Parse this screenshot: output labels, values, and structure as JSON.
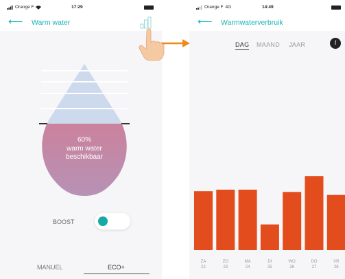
{
  "left_screen": {
    "status": {
      "carrier": "Orange F",
      "time": "17:29"
    },
    "nav": {
      "back_icon": "arrow-left-icon",
      "title": "Warm water",
      "chart_icon": "bar-chart-icon"
    },
    "tank": {
      "level_percent": 60,
      "line1": "60%",
      "line2": "warm water",
      "line3": "beschikbaar",
      "fill_color": "#d37f8e"
    },
    "boost": {
      "label": "BOOST",
      "on": false,
      "knob_color": "#17a8a8"
    },
    "modes": {
      "items": [
        "MANUEL",
        "ECO+"
      ],
      "active": "ECO+"
    }
  },
  "overlay": {
    "hand_icon": "pointing-hand-icon",
    "arrow_icon": "arrow-right-icon",
    "arrow_color": "#ee8a1c"
  },
  "right_screen": {
    "status": {
      "carrier": "Orange F",
      "network": "4G",
      "time": "14:49"
    },
    "nav": {
      "back_icon": "arrow-left-icon",
      "title": "Warmwaterverbruik"
    },
    "period_tabs": {
      "items": [
        "DAG",
        "MAAND",
        "JAAR"
      ],
      "active": "DAG"
    },
    "info_icon": "info-icon",
    "info_label": "i",
    "accent_color": "#17b3b5",
    "bar_color": "#e34d1e"
  },
  "chart_data": {
    "type": "bar",
    "categories": [
      "ZA 22",
      "ZO 23",
      "MA 24",
      "DI 25",
      "WO 26",
      "DO 27",
      "VR 28"
    ],
    "day_labels": [
      "ZA",
      "ZO",
      "MA",
      "DI",
      "WO",
      "DO",
      "VR"
    ],
    "date_labels": [
      "22",
      "23",
      "24",
      "25",
      "26",
      "27",
      "28"
    ],
    "values": [
      78,
      80,
      80,
      34,
      77,
      98,
      73
    ],
    "ylim": [
      0,
      100
    ],
    "title": "",
    "xlabel": "",
    "ylabel": "",
    "grid": false,
    "legend": "none"
  }
}
